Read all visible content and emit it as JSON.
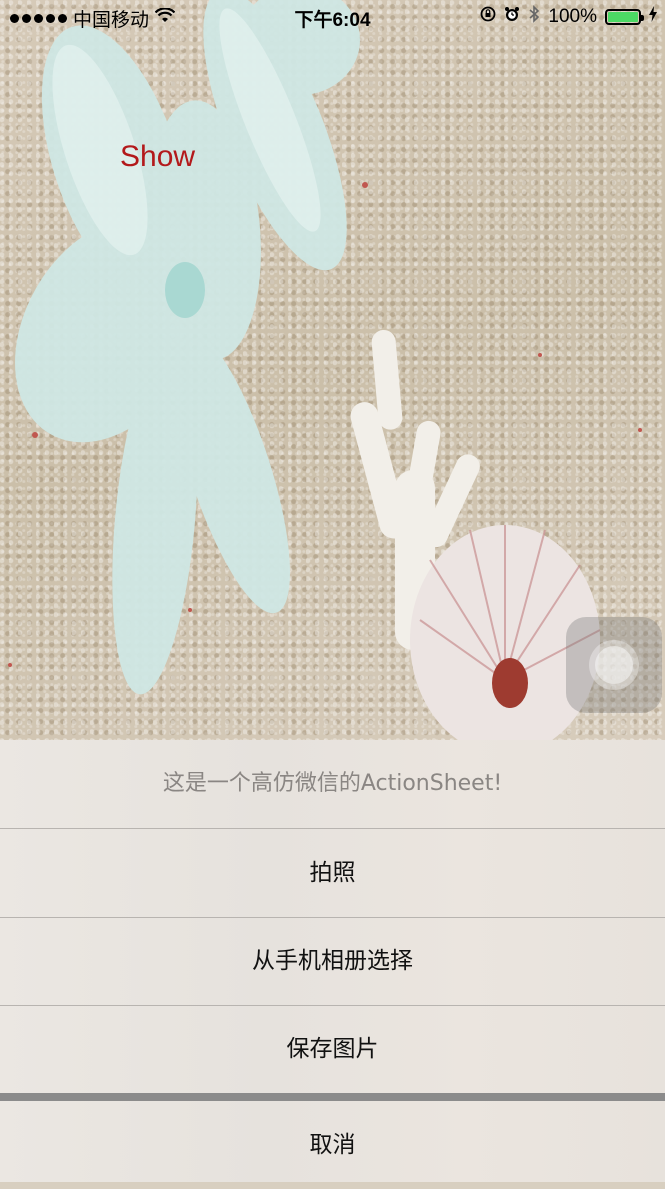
{
  "status_bar": {
    "carrier": "中国移动",
    "time": "下午6:04",
    "battery": "100%",
    "battery_level": 100,
    "icons": [
      "signal-dots-icon",
      "wifi-icon",
      "orientation-lock-icon",
      "alarm-icon",
      "bluetooth-icon",
      "battery-icon",
      "charging-icon"
    ],
    "battery_color": "#4cd964"
  },
  "main": {
    "show_label": "Show",
    "show_color": "#b3191b"
  },
  "action_sheet": {
    "title": "这是一个高仿微信的ActionSheet!",
    "items": [
      {
        "label": "拍照"
      },
      {
        "label": "从手机相册选择"
      },
      {
        "label": "保存图片"
      }
    ],
    "cancel_label": "取消"
  }
}
